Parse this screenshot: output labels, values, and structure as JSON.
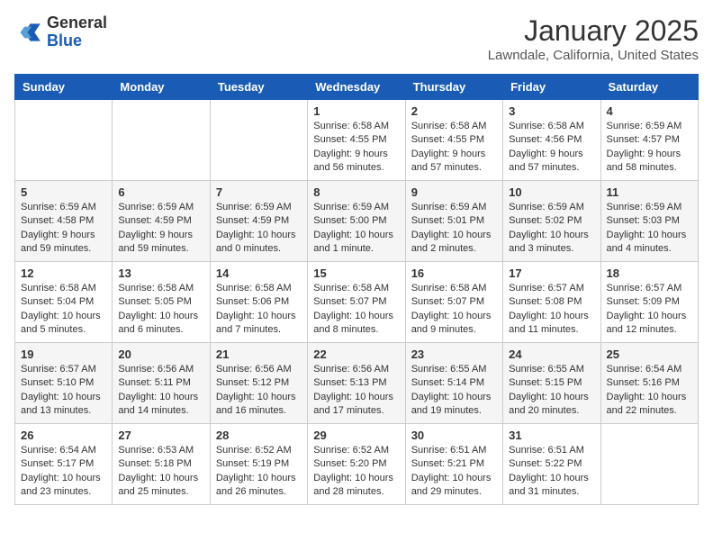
{
  "logo": {
    "general": "General",
    "blue": "Blue"
  },
  "title": "January 2025",
  "location": "Lawndale, California, United States",
  "days_of_week": [
    "Sunday",
    "Monday",
    "Tuesday",
    "Wednesday",
    "Thursday",
    "Friday",
    "Saturday"
  ],
  "weeks": [
    [
      {
        "day": "",
        "detail": ""
      },
      {
        "day": "",
        "detail": ""
      },
      {
        "day": "",
        "detail": ""
      },
      {
        "day": "1",
        "detail": "Sunrise: 6:58 AM\nSunset: 4:55 PM\nDaylight: 9 hours\nand 56 minutes."
      },
      {
        "day": "2",
        "detail": "Sunrise: 6:58 AM\nSunset: 4:55 PM\nDaylight: 9 hours\nand 57 minutes."
      },
      {
        "day": "3",
        "detail": "Sunrise: 6:58 AM\nSunset: 4:56 PM\nDaylight: 9 hours\nand 57 minutes."
      },
      {
        "day": "4",
        "detail": "Sunrise: 6:59 AM\nSunset: 4:57 PM\nDaylight: 9 hours\nand 58 minutes."
      }
    ],
    [
      {
        "day": "5",
        "detail": "Sunrise: 6:59 AM\nSunset: 4:58 PM\nDaylight: 9 hours\nand 59 minutes."
      },
      {
        "day": "6",
        "detail": "Sunrise: 6:59 AM\nSunset: 4:59 PM\nDaylight: 9 hours\nand 59 minutes."
      },
      {
        "day": "7",
        "detail": "Sunrise: 6:59 AM\nSunset: 4:59 PM\nDaylight: 10 hours\nand 0 minutes."
      },
      {
        "day": "8",
        "detail": "Sunrise: 6:59 AM\nSunset: 5:00 PM\nDaylight: 10 hours\nand 1 minute."
      },
      {
        "day": "9",
        "detail": "Sunrise: 6:59 AM\nSunset: 5:01 PM\nDaylight: 10 hours\nand 2 minutes."
      },
      {
        "day": "10",
        "detail": "Sunrise: 6:59 AM\nSunset: 5:02 PM\nDaylight: 10 hours\nand 3 minutes."
      },
      {
        "day": "11",
        "detail": "Sunrise: 6:59 AM\nSunset: 5:03 PM\nDaylight: 10 hours\nand 4 minutes."
      }
    ],
    [
      {
        "day": "12",
        "detail": "Sunrise: 6:58 AM\nSunset: 5:04 PM\nDaylight: 10 hours\nand 5 minutes."
      },
      {
        "day": "13",
        "detail": "Sunrise: 6:58 AM\nSunset: 5:05 PM\nDaylight: 10 hours\nand 6 minutes."
      },
      {
        "day": "14",
        "detail": "Sunrise: 6:58 AM\nSunset: 5:06 PM\nDaylight: 10 hours\nand 7 minutes."
      },
      {
        "day": "15",
        "detail": "Sunrise: 6:58 AM\nSunset: 5:07 PM\nDaylight: 10 hours\nand 8 minutes."
      },
      {
        "day": "16",
        "detail": "Sunrise: 6:58 AM\nSunset: 5:07 PM\nDaylight: 10 hours\nand 9 minutes."
      },
      {
        "day": "17",
        "detail": "Sunrise: 6:57 AM\nSunset: 5:08 PM\nDaylight: 10 hours\nand 11 minutes."
      },
      {
        "day": "18",
        "detail": "Sunrise: 6:57 AM\nSunset: 5:09 PM\nDaylight: 10 hours\nand 12 minutes."
      }
    ],
    [
      {
        "day": "19",
        "detail": "Sunrise: 6:57 AM\nSunset: 5:10 PM\nDaylight: 10 hours\nand 13 minutes."
      },
      {
        "day": "20",
        "detail": "Sunrise: 6:56 AM\nSunset: 5:11 PM\nDaylight: 10 hours\nand 14 minutes."
      },
      {
        "day": "21",
        "detail": "Sunrise: 6:56 AM\nSunset: 5:12 PM\nDaylight: 10 hours\nand 16 minutes."
      },
      {
        "day": "22",
        "detail": "Sunrise: 6:56 AM\nSunset: 5:13 PM\nDaylight: 10 hours\nand 17 minutes."
      },
      {
        "day": "23",
        "detail": "Sunrise: 6:55 AM\nSunset: 5:14 PM\nDaylight: 10 hours\nand 19 minutes."
      },
      {
        "day": "24",
        "detail": "Sunrise: 6:55 AM\nSunset: 5:15 PM\nDaylight: 10 hours\nand 20 minutes."
      },
      {
        "day": "25",
        "detail": "Sunrise: 6:54 AM\nSunset: 5:16 PM\nDaylight: 10 hours\nand 22 minutes."
      }
    ],
    [
      {
        "day": "26",
        "detail": "Sunrise: 6:54 AM\nSunset: 5:17 PM\nDaylight: 10 hours\nand 23 minutes."
      },
      {
        "day": "27",
        "detail": "Sunrise: 6:53 AM\nSunset: 5:18 PM\nDaylight: 10 hours\nand 25 minutes."
      },
      {
        "day": "28",
        "detail": "Sunrise: 6:52 AM\nSunset: 5:19 PM\nDaylight: 10 hours\nand 26 minutes."
      },
      {
        "day": "29",
        "detail": "Sunrise: 6:52 AM\nSunset: 5:20 PM\nDaylight: 10 hours\nand 28 minutes."
      },
      {
        "day": "30",
        "detail": "Sunrise: 6:51 AM\nSunset: 5:21 PM\nDaylight: 10 hours\nand 29 minutes."
      },
      {
        "day": "31",
        "detail": "Sunrise: 6:51 AM\nSunset: 5:22 PM\nDaylight: 10 hours\nand 31 minutes."
      },
      {
        "day": "",
        "detail": ""
      }
    ]
  ]
}
